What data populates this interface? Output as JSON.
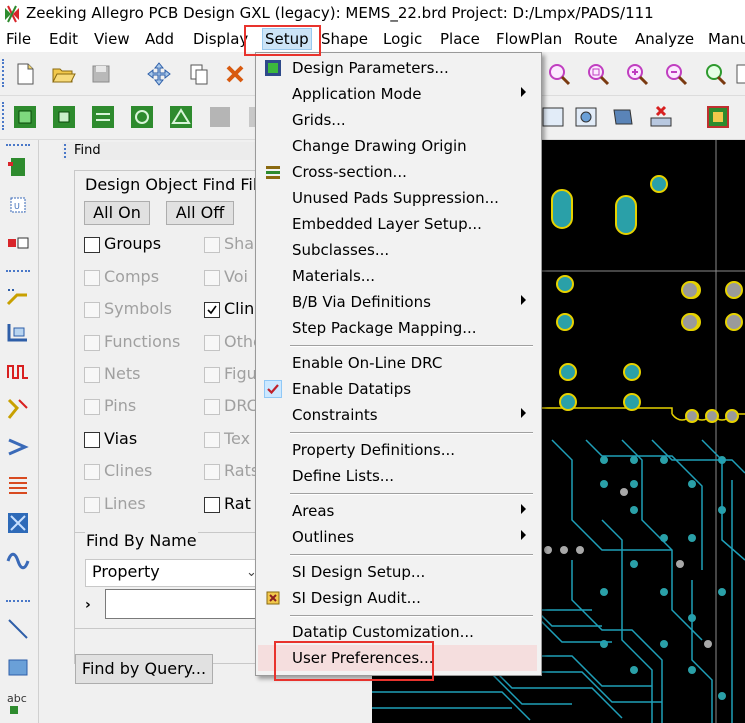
{
  "window": {
    "title": "Zeeking Allegro PCB Design GXL (legacy): MEMS_22.brd  Project: D:/Lmpx/PADS/111"
  },
  "menubar": {
    "items": [
      "File",
      "Edit",
      "View",
      "Add",
      "Display",
      "Setup",
      "Shape",
      "Logic",
      "Place",
      "FlowPlan",
      "Route",
      "Analyze",
      "Manu"
    ],
    "open_item": "Setup"
  },
  "setup_menu": {
    "items": [
      {
        "label": "Design Parameters...",
        "icon": "design-parameters-icon"
      },
      {
        "label": "Application Mode",
        "submenu": true
      },
      {
        "label": "Grids..."
      },
      {
        "label": "Change Drawing Origin"
      },
      {
        "label": "Cross-section...",
        "icon": "cross-section-icon"
      },
      {
        "label": "Unused Pads Suppression..."
      },
      {
        "label": "Embedded Layer Setup..."
      },
      {
        "label": "Subclasses..."
      },
      {
        "label": "Materials..."
      },
      {
        "label": "B/B Via Definitions",
        "submenu": true
      },
      {
        "label": "Step Package Mapping..."
      },
      {
        "label": "Enable On-Line DRC"
      },
      {
        "label": "Enable Datatips",
        "checked": true
      },
      {
        "label": "Constraints",
        "submenu": true
      },
      {
        "label": "Property Definitions..."
      },
      {
        "label": "Define Lists..."
      },
      {
        "label": "Areas",
        "submenu": true
      },
      {
        "label": "Outlines",
        "submenu": true
      },
      {
        "label": "SI Design Setup..."
      },
      {
        "label": "SI Design Audit...",
        "icon": "si-audit-icon"
      },
      {
        "label": "Datatip Customization..."
      },
      {
        "label": "User Preferences...",
        "highlighted": true
      }
    ]
  },
  "find_panel": {
    "title": "Find",
    "group_title": "Design Object Find Filt",
    "all_on": "All On",
    "all_off": "All Off",
    "left_items": [
      {
        "label": "Groups",
        "enabled": true,
        "checked": false
      },
      {
        "label": "Comps",
        "enabled": false,
        "checked": false
      },
      {
        "label": "Symbols",
        "enabled": false,
        "checked": false
      },
      {
        "label": "Functions",
        "enabled": false,
        "checked": false
      },
      {
        "label": "Nets",
        "enabled": false,
        "checked": false
      },
      {
        "label": "Pins",
        "enabled": false,
        "checked": false
      },
      {
        "label": "Vias",
        "enabled": true,
        "checked": false
      },
      {
        "label": "Clines",
        "enabled": false,
        "checked": false
      },
      {
        "label": "Lines",
        "enabled": false,
        "checked": false
      }
    ],
    "right_items": [
      {
        "label": "Sha",
        "enabled": false,
        "checked": false
      },
      {
        "label": "Voi",
        "enabled": false,
        "checked": false
      },
      {
        "label": "Clin",
        "enabled": true,
        "checked": true
      },
      {
        "label": "Othe",
        "enabled": false,
        "checked": false
      },
      {
        "label": "Figu",
        "enabled": false,
        "checked": false
      },
      {
        "label": "DRC",
        "enabled": false,
        "checked": false
      },
      {
        "label": "Tex",
        "enabled": false,
        "checked": false
      },
      {
        "label": "Rats",
        "enabled": false,
        "checked": false
      },
      {
        "label": "Rat",
        "enabled": true,
        "checked": false
      }
    ],
    "find_by_name_title": "Find By Name",
    "find_by_name_type": "Property",
    "find_by_name_value": "",
    "find_by_query": "Find by Query..."
  },
  "left_toolbar": {
    "bottom_label": "abc"
  },
  "colors": {
    "highlight_box": "#e8332d",
    "menu_hover": "#f5dede",
    "canvas_bg": "#000000",
    "pad_ring": "#e6d200",
    "via_fill": "#2aa0a8",
    "trace": "#1f9fb8"
  }
}
